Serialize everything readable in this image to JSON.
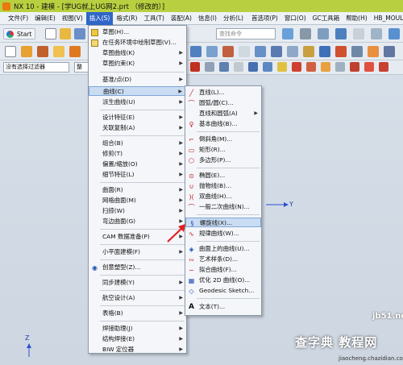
{
  "window": {
    "title": "NX 10 - 建模 - [学UG就上UG网2.prt （修改的）]"
  },
  "menubar": {
    "items": [
      {
        "label": "文件(F)"
      },
      {
        "label": "编辑(E)"
      },
      {
        "label": "视图(V)"
      },
      {
        "label": "插入(S)"
      },
      {
        "label": "格式(R)"
      },
      {
        "label": "工具(T)"
      },
      {
        "label": "装配(A)"
      },
      {
        "label": "信息(I)"
      },
      {
        "label": "分析(L)"
      },
      {
        "label": "首选项(P)"
      },
      {
        "label": "窗口(O)"
      },
      {
        "label": "GC工具箱"
      },
      {
        "label": "帮助(H)"
      },
      {
        "label": "HB_MOULD"
      }
    ],
    "active_index": 3
  },
  "toolbar": {
    "start_label": "Start",
    "search_placeholder": "查找命令",
    "filter_value": "没有选择过滤器",
    "filter2_value": "整"
  },
  "insert_menu": {
    "items": [
      {
        "label": "草图(H)...",
        "submenu": false
      },
      {
        "label": "在任务环境中绘制草图(V)...",
        "submenu": false
      },
      {
        "label": "草图曲线(K)",
        "submenu": true
      },
      {
        "label": "草图约束(K)",
        "submenu": true
      },
      {
        "label": "基准/点(D)",
        "submenu": true
      },
      {
        "label": "曲线(C)",
        "submenu": true
      },
      {
        "label": "派生曲线(U)",
        "submenu": true
      },
      {
        "label": "设计特征(E)",
        "submenu": true
      },
      {
        "label": "关联复制(A)",
        "submenu": true
      },
      {
        "label": "组合(B)",
        "submenu": true
      },
      {
        "label": "修剪(T)",
        "submenu": true
      },
      {
        "label": "偏置/缩放(O)",
        "submenu": true
      },
      {
        "label": "细节特征(L)",
        "submenu": true
      },
      {
        "label": "曲面(R)",
        "submenu": true
      },
      {
        "label": "网格曲面(M)",
        "submenu": true
      },
      {
        "label": "扫掠(W)",
        "submenu": true
      },
      {
        "label": "弯边曲面(G)",
        "submenu": true
      },
      {
        "label": "CAM 数据准备(P)",
        "submenu": true
      },
      {
        "label": "小平面建模(F)",
        "submenu": true
      },
      {
        "label": "创意塑型(Z)...",
        "submenu": false
      },
      {
        "label": "同步建模(Y)",
        "submenu": true
      },
      {
        "label": "航空设计(A)",
        "submenu": true
      },
      {
        "label": "表格(B)",
        "submenu": true
      },
      {
        "label": "焊接助理(J)",
        "submenu": true
      },
      {
        "label": "结构焊接(E)",
        "submenu": true
      },
      {
        "label": "BIW 定位器",
        "submenu": true
      }
    ],
    "highlighted_index": 5
  },
  "curve_menu": {
    "items": [
      {
        "label": "直线(L)...",
        "icon": "line-icon"
      },
      {
        "label": "圆弧/圆(C)...",
        "icon": "arc-icon"
      },
      {
        "label": "直线和圆弧(A)",
        "icon": "line-arc-icon",
        "submenu": true
      },
      {
        "label": "基本曲线(B)...",
        "icon": "basic-curve-icon"
      },
      {
        "label": "倒斜角(M)...",
        "icon": "chamfer-icon"
      },
      {
        "label": "矩形(R)...",
        "icon": "rectangle-icon"
      },
      {
        "label": "多边形(P)...",
        "icon": "polygon-icon"
      },
      {
        "label": "椭圆(E)...",
        "icon": "ellipse-icon"
      },
      {
        "label": "抛物线(B)...",
        "icon": "parabola-icon"
      },
      {
        "label": "双曲线(H)...",
        "icon": "hyperbola-icon"
      },
      {
        "label": "一般二次曲线(N)...",
        "icon": "conic-icon"
      },
      {
        "label": "螺旋线(X)...",
        "icon": "helix-icon"
      },
      {
        "label": "规律曲线(W)...",
        "icon": "law-curve-icon"
      },
      {
        "label": "曲面上的曲线(U)...",
        "icon": "curve-on-surface-icon"
      },
      {
        "label": "艺术样条(D)...",
        "icon": "studio-spline-icon"
      },
      {
        "label": "拟合曲线(F)...",
        "icon": "fit-curve-icon"
      },
      {
        "label": "优化 2D 曲线(O)...",
        "icon": "optimize-2d-icon"
      },
      {
        "label": "Geodesic Sketch...",
        "icon": "geodesic-sketch-icon"
      },
      {
        "label": "文本(T)...",
        "icon": "text-icon"
      }
    ],
    "highlighted_index": 11
  },
  "canvas": {
    "axis_y_label": "Y",
    "axis_z_label": "Z"
  },
  "watermark": {
    "line1": "jb51.net",
    "line2": "查字典 教程网",
    "line3": "jiaocheng.chazidian.com"
  }
}
